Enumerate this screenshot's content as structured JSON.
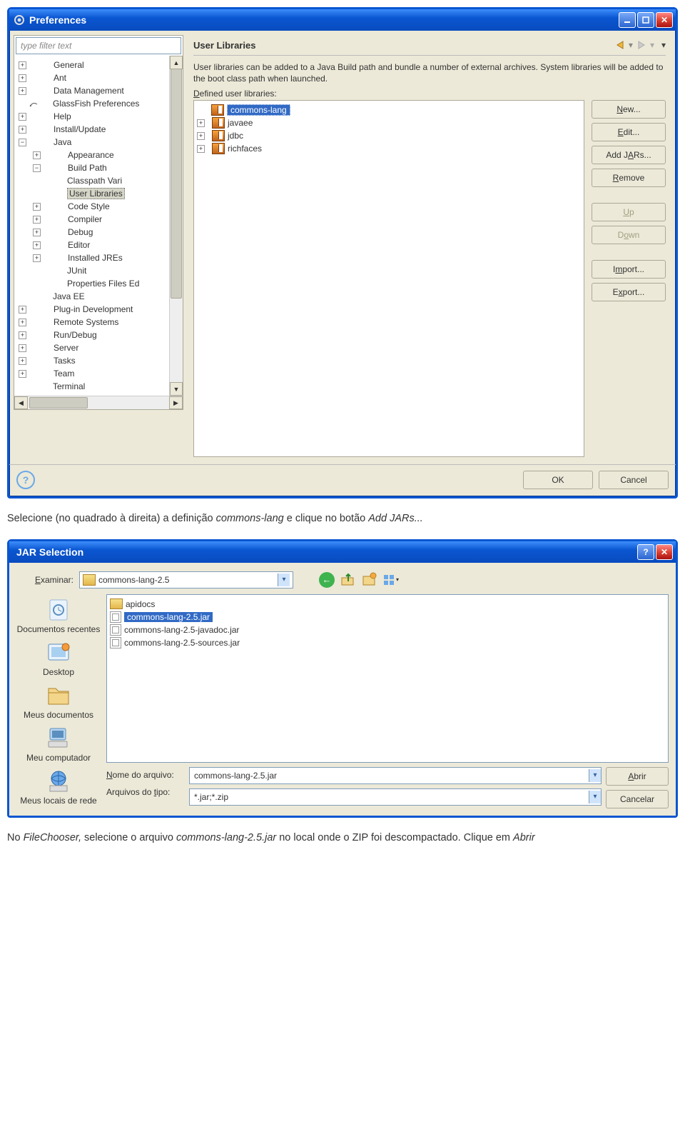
{
  "prefs": {
    "title": "Preferences",
    "filter_placeholder": "type filter text",
    "tree": {
      "items": [
        "General",
        "Ant",
        "Data Management",
        "GlassFish Preferences",
        "Help",
        "Install/Update",
        "Java"
      ],
      "java_children": [
        "Appearance",
        "Build Path"
      ],
      "buildpath_children": [
        "Classpath Vari",
        "User Libraries"
      ],
      "java_rest": [
        "Code Style",
        "Compiler",
        "Debug",
        "Editor",
        "Installed JREs",
        "JUnit",
        "Properties Files Ed"
      ],
      "rest": [
        "Java EE",
        "Plug-in Development",
        "Remote Systems",
        "Run/Debug",
        "Server",
        "Tasks",
        "Team",
        "Terminal"
      ]
    },
    "detail": {
      "title": "User Libraries",
      "desc1": "User libraries can be added to a Java Build path and bundle a number of external archives. System libraries will be added to the boot class path when launched.",
      "label_defined": "Defined user libraries:",
      "libs": [
        "commons-lang",
        "javaee",
        "jdbc",
        "richfaces"
      ],
      "buttons": {
        "new": "New...",
        "edit": "Edit...",
        "addjars": "Add JARs...",
        "remove": "Remove",
        "up": "Up",
        "down": "Down",
        "import": "Import...",
        "export": "Export..."
      }
    },
    "footer": {
      "ok": "OK",
      "cancel": "Cancel"
    }
  },
  "caption1_a": "Selecione (no quadrado à direita) a definição ",
  "caption1_em1": "commons-lang",
  "caption1_b": " e clique no botão ",
  "caption1_em2": "Add JARs...",
  "jar": {
    "title": "JAR Selection",
    "examinar": "Examinar:",
    "folder": "commons-lang-2.5",
    "places": [
      "Documentos recentes",
      "Desktop",
      "Meus documentos",
      "Meu computador",
      "Meus locais de rede"
    ],
    "files": {
      "folder": "apidocs",
      "selected": "commons-lang-2.5.jar",
      "rest": [
        "commons-lang-2.5-javadoc.jar",
        "commons-lang-2.5-sources.jar"
      ]
    },
    "bottom": {
      "nome_label": "Nome do arquivo:",
      "nome_value": "commons-lang-2.5.jar",
      "tipo_label": "Arquivos do tipo:",
      "tipo_value": "*.jar;*.zip",
      "abrir": "Abrir",
      "cancelar": "Cancelar"
    }
  },
  "caption2_a": "No ",
  "caption2_em1": "FileChooser,",
  "caption2_b": " selecione o arquivo ",
  "caption2_em2": "commons-lang-2.5.jar",
  "caption2_c": " no local onde o ZIP foi descompactado. Clique em ",
  "caption2_em3": "Abrir"
}
